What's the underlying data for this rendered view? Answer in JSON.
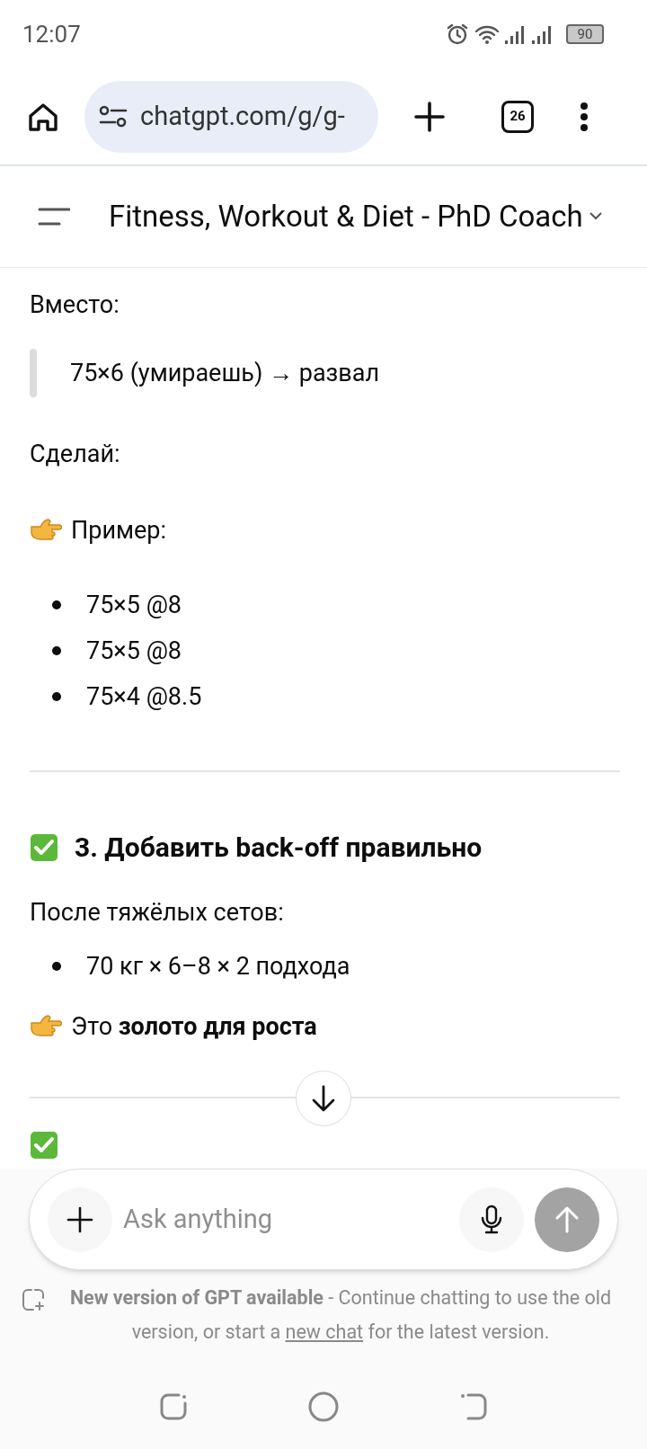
{
  "status_bar": {
    "time": "12:07",
    "battery": "90"
  },
  "browser": {
    "url": "chatgpt.com/g/g-",
    "tab_count": "26"
  },
  "header": {
    "title": "Fitness, Workout & Diet - PhD Coach"
  },
  "content": [
    {
      "kind": "para",
      "text": "Вместо:"
    },
    {
      "kind": "quote",
      "text": "75×6 (умираешь) → развал"
    },
    {
      "kind": "para_wide",
      "text": "Сделай:"
    },
    {
      "kind": "point",
      "text": "Пример:"
    },
    {
      "kind": "bullets",
      "items": [
        "75×5 @8",
        "75×5 @8",
        "75×4 @8.5"
      ]
    },
    {
      "kind": "rule"
    },
    {
      "kind": "heading",
      "text": "3. Добавить back-off правильно"
    },
    {
      "kind": "para_tight",
      "text": "После тяжёлых сетов:"
    },
    {
      "kind": "bullets_tight",
      "items": [
        "70 кг × 6–8 × 2 подхода"
      ]
    },
    {
      "kind": "point_tight",
      "text": "Это **золото для роста**"
    }
  ],
  "composer": {
    "placeholder": "Ask anything"
  },
  "notice": {
    "before": "**New version of GPT available** - Continue chatting to use the old version, or start a ",
    "link": "new chat",
    "after": " for the latest version."
  }
}
